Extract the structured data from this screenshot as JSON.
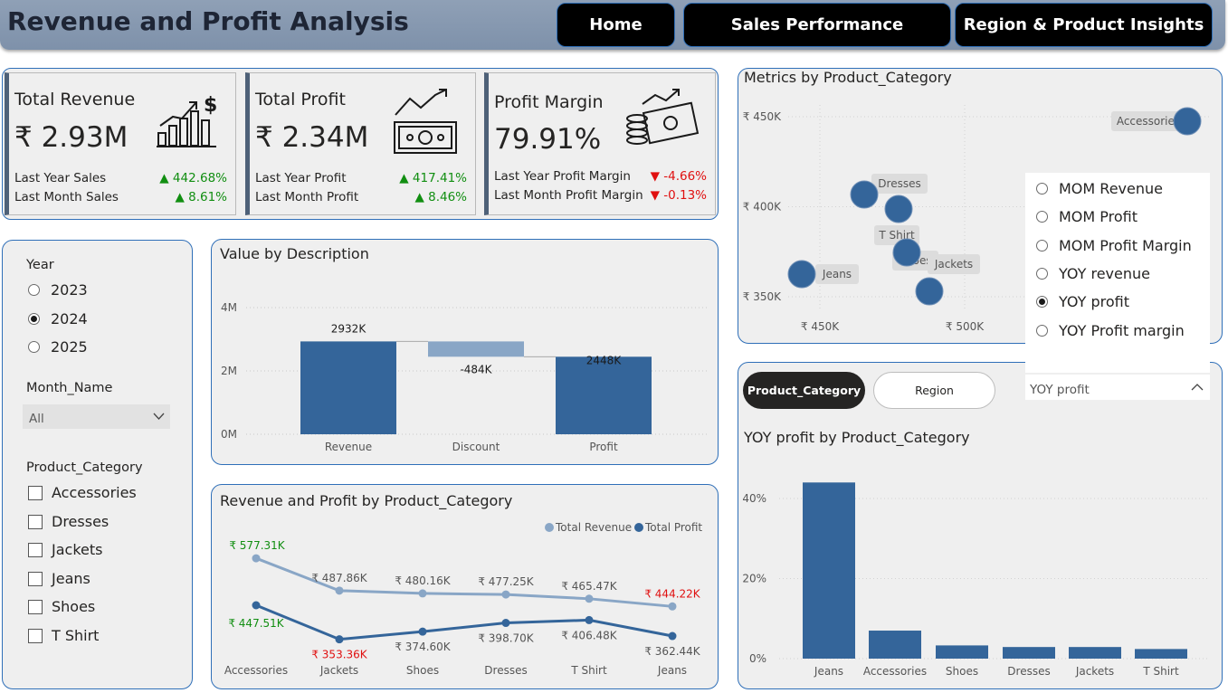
{
  "header": {
    "title": "Revenue and Profit Analysis",
    "nav": [
      "Home",
      "Sales Performance",
      "Region & Product Insights"
    ]
  },
  "kpis": [
    {
      "title": "Total Revenue",
      "value": "₹ 2.93M",
      "icon": "bar-chart-dollar-icon",
      "rows": [
        {
          "label": "Last Year Sales",
          "change": "▲ 442.68%",
          "dir": "up"
        },
        {
          "label": "Last Month Sales",
          "change": "▲ 8.61%",
          "dir": "up"
        }
      ]
    },
    {
      "title": "Total Profit",
      "value": "₹ 2.34M",
      "icon": "money-trend-icon",
      "rows": [
        {
          "label": "Last Year Profit",
          "change": "▲ 417.41%",
          "dir": "up"
        },
        {
          "label": "Last Month Profit",
          "change": "▲ 8.46%",
          "dir": "up"
        }
      ]
    },
    {
      "title": "Profit Margin",
      "value": "79.91%",
      "icon": "cash-coins-icon",
      "rows": [
        {
          "label": "Last Year Profit Margin",
          "change": "▼ -4.66%",
          "dir": "down"
        },
        {
          "label": "Last Month Profit Margin",
          "change": "▼ -0.13%",
          "dir": "down"
        }
      ]
    }
  ],
  "filters": {
    "year_label": "Year",
    "years": [
      "2023",
      "2024",
      "2025"
    ],
    "selected_year": "2024",
    "month_label": "Month_Name",
    "month_value": "All",
    "category_label": "Product_Category",
    "categories": [
      "Accessories",
      "Dresses",
      "Jackets",
      "Jeans",
      "Shoes",
      "T Shirt"
    ]
  },
  "colors": {
    "dark_blue": "#34659a",
    "light_blue": "#89a6c6",
    "up": "#118e11",
    "down": "#e01010"
  },
  "waterfall": {
    "title": "Value by Description",
    "chart_data": {
      "type": "bar",
      "categories": [
        "Revenue",
        "Discount",
        "Profit"
      ],
      "values": [
        2932,
        -484,
        2448
      ],
      "labels": [
        "2932K",
        "-484K",
        "2448K"
      ],
      "yticks": [
        "0M",
        "2M",
        "4M"
      ],
      "ylim": [
        0,
        4000
      ]
    }
  },
  "line": {
    "title": "Revenue and Profit by Product_Category",
    "chart_data": {
      "type": "line",
      "categories": [
        "Accessories",
        "Jackets",
        "Shoes",
        "Dresses",
        "T Shirt",
        "Jeans"
      ],
      "series": [
        {
          "name": "Total Revenue",
          "values": [
            577.31,
            487.86,
            480.16,
            477.25,
            465.47,
            444.22
          ],
          "labels": [
            "₹ 577.31K",
            "₹ 487.86K",
            "₹ 480.16K",
            "₹ 477.25K",
            "₹ 465.47K",
            "₹ 444.22K"
          ],
          "label_colors": [
            "up",
            "normal",
            "normal",
            "normal",
            "normal",
            "down"
          ]
        },
        {
          "name": "Total Profit",
          "values": [
            447.51,
            353.36,
            374.6,
            398.7,
            406.48,
            362.44
          ],
          "labels": [
            "₹ 447.51K",
            "₹ 353.36K",
            "₹ 374.60K",
            "₹ 398.70K",
            "₹ 406.48K",
            "₹ 362.44K"
          ],
          "label_colors": [
            "up",
            "down",
            "normal",
            "normal",
            "normal",
            "normal"
          ]
        }
      ],
      "legend": "top-right"
    }
  },
  "scatter": {
    "title": "Metrics by Product_Category",
    "chart_data": {
      "type": "scatter",
      "x_ticks": [
        "₹ 450K",
        "₹ 500K"
      ],
      "y_ticks": [
        "₹ 450K",
        "₹ 400K",
        "₹ 350K"
      ],
      "points": [
        {
          "label": "Accessories",
          "x": 577,
          "y": 447
        },
        {
          "label": "Dresses",
          "x": 477,
          "y": 399
        },
        {
          "label": "T Shirt",
          "x": 466,
          "y": 406
        },
        {
          "label": "Shoes",
          "x": 480,
          "y": 375
        },
        {
          "label": "Jackets",
          "x": 488,
          "y": 353
        },
        {
          "label": "Jeans",
          "x": 444,
          "y": 362
        }
      ]
    }
  },
  "metric_selector": {
    "options": [
      "MOM Revenue",
      "MOM Profit",
      "MOM Profit Margin",
      "YOY revenue",
      "YOY profit",
      "YOY Profit margin"
    ],
    "selected": "YOY profit",
    "current": "YOY profit"
  },
  "toggle": {
    "options": [
      "Product_Category",
      "Region"
    ],
    "active": "Product_Category"
  },
  "yoy": {
    "title": "YOY profit by Product_Category",
    "chart_data": {
      "type": "bar",
      "categories": [
        "Jeans",
        "Accessories",
        "Shoes",
        "Dresses",
        "Jackets",
        "T Shirt"
      ],
      "values": [
        44,
        7,
        3.3,
        2.9,
        2.9,
        2.4
      ],
      "yticks": [
        "0%",
        "20%",
        "40%"
      ],
      "ylim": [
        0,
        47
      ]
    }
  }
}
